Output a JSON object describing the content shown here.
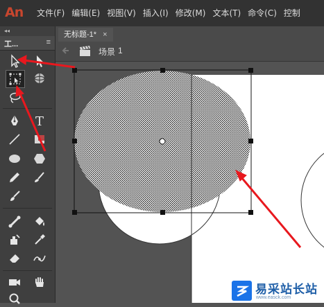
{
  "app": {
    "logo": "An"
  },
  "menu": [
    "文件(F)",
    "编辑(E)",
    "视图(V)",
    "插入(I)",
    "修改(M)",
    "文本(T)",
    "命令(C)",
    "控制"
  ],
  "toolbox": {
    "collapse_glyph": "◂◂",
    "title": "工...",
    "menu_glyph": "≡",
    "tools": [
      "selection-tool",
      "subselection-tool",
      "free-transform-tool",
      "3d-rotation-tool",
      "lasso-tool",
      "pen-tool",
      "text-tool",
      "line-tool",
      "rectangle-tool",
      "oval-tool",
      "polystar-tool",
      "pencil-tool",
      "brush-tool",
      "paint-brush-tool",
      "bone-tool",
      "paint-bucket-tool",
      "ink-bottle-tool",
      "eyedropper-tool",
      "eraser-tool",
      "width-tool",
      "camera-tool",
      "hand-tool",
      "zoom-tool"
    ]
  },
  "document": {
    "tab_title": "无标题-1*",
    "close_glyph": "×"
  },
  "editbar": {
    "scene_label": "场景",
    "scene_number": "1"
  },
  "watermark": {
    "text": "易采站长站",
    "url": "www.easck.com"
  },
  "colors": {
    "annotation_arrow": "#e8181e",
    "accent": "#c8462e"
  }
}
